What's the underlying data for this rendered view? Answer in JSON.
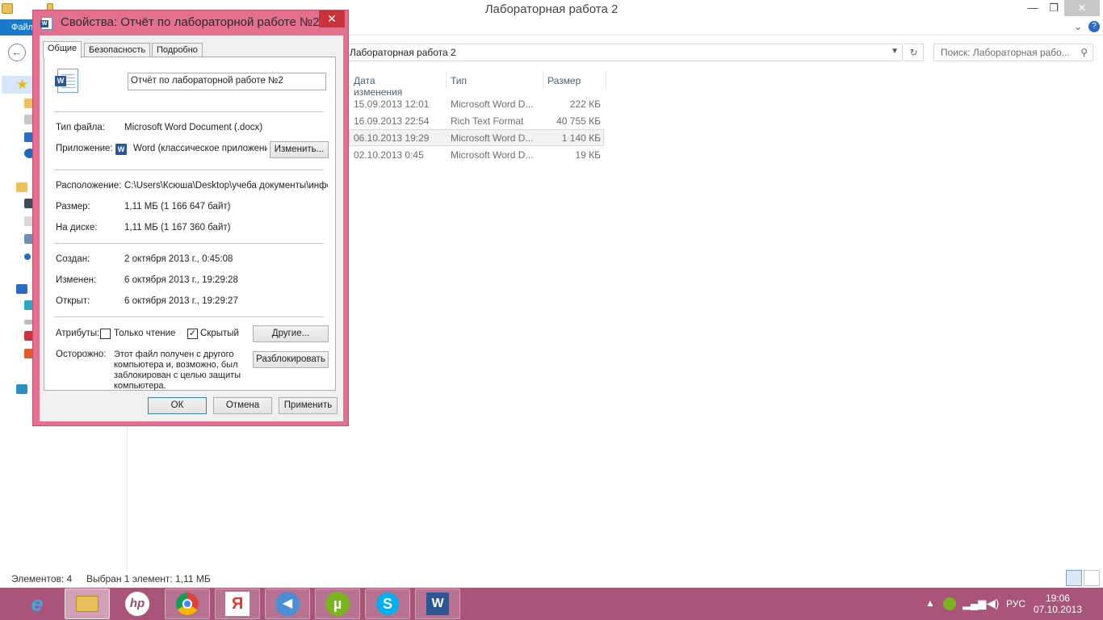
{
  "explorer": {
    "title": "Лабораторная работа 2",
    "window_controls": {
      "minimize": "—",
      "maximize": "❐",
      "close": "✕"
    },
    "ribbon": {
      "file_tab": "Файл",
      "expand": "⌄",
      "help": "?"
    },
    "address": "Лабораторная работа 2",
    "search_placeholder": "Поиск: Лабораторная рабо...",
    "columns": [
      "Дата изменения",
      "Тип",
      "Размер"
    ],
    "rows": [
      {
        "date": "15.09.2013 12:01",
        "type": "Microsoft Word D...",
        "size": "222 КБ",
        "selected": false
      },
      {
        "date": "16.09.2013 22:54",
        "type": "Rich Text Format",
        "size": "40 755 КБ",
        "selected": false
      },
      {
        "date": "06.10.2013 19:29",
        "type": "Microsoft Word D...",
        "size": "1 140 КБ",
        "selected": true
      },
      {
        "date": "02.10.2013 0:45",
        "type": "Microsoft Word D...",
        "size": "19 КБ",
        "selected": false
      }
    ],
    "status": {
      "count": "Элементов: 4",
      "selection": "Выбран 1 элемент: 1,11 МБ"
    }
  },
  "dialog": {
    "title": "Свойства: Отчёт по лабораторной работе №2",
    "close": "✕",
    "tabs": [
      "Общие",
      "Безопасность",
      "Подробно"
    ],
    "file_name": "Отчёт по лабораторной работе №2",
    "file_type_label": "Тип файла:",
    "file_type_value": "Microsoft Word Document (.docx)",
    "app_label": "Приложение:",
    "app_value": "Word (классическое приложени",
    "change_button": "Изменить...",
    "location_label": "Расположение:",
    "location_value": "C:\\Users\\Ксюша\\Desktop\\учеба документы\\инфо",
    "size_label": "Размер:",
    "size_value": "1,11 МБ (1 166 647 байт)",
    "disk_label": "На диске:",
    "disk_value": "1,11 МБ (1 167 360 байт)",
    "created_label": "Создан:",
    "created_value": "2 октября 2013 г., 0:45:08",
    "modified_label": "Изменен:",
    "modified_value": "6 октября 2013 г., 19:29:28",
    "opened_label": "Открыт:",
    "opened_value": "6 октября 2013 г., 19:29:27",
    "attributes_label": "Атрибуты:",
    "readonly_label": "Только чтение",
    "readonly_checked": false,
    "hidden_label": "Скрытый",
    "hidden_checked": true,
    "other_button": "Другие...",
    "caution_label": "Осторожно:",
    "caution_text": "Этот файл получен с другого компьютера и, возможно, был заблокирован с целью защиты компьютера.",
    "unblock_button": "Разблокировать",
    "ok_button": "ОК",
    "cancel_button": "Отмена",
    "apply_button": "Применить"
  },
  "taskbar": {
    "items": [
      "internet-explorer",
      "file-explorer",
      "hp",
      "chrome",
      "yandex",
      "media-player",
      "utorrent",
      "skype",
      "word"
    ],
    "labels": {
      "hp": "hp",
      "yandex": "Я",
      "utorrent": "µ",
      "skype": "S",
      "word": "W"
    },
    "language": "РУС",
    "time": "19:06",
    "date": "07.10.2013"
  }
}
